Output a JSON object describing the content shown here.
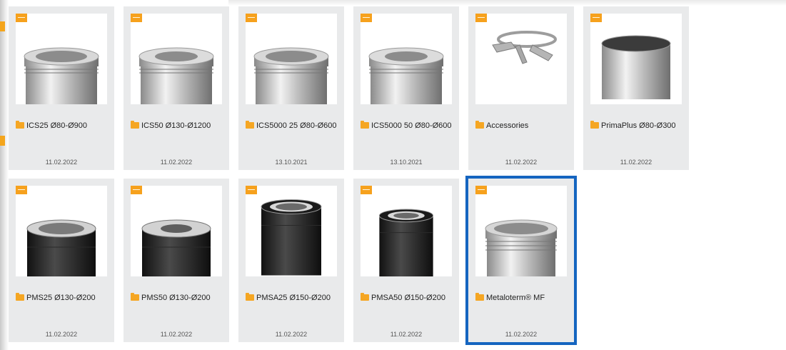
{
  "colors": {
    "tag": "#f6a11d",
    "folder": "#f5a623",
    "selection": "#1565c0",
    "card_bg": "#e9eaeb"
  },
  "folders": [
    {
      "name": "ICS25 Ø80-Ø900",
      "date": "11.02.2022",
      "icon": "folder-icon",
      "image": "steel-pipe"
    },
    {
      "name": "ICS50 Ø130-Ø1200",
      "date": "11.02.2022",
      "icon": "folder-icon",
      "image": "steel-pipe"
    },
    {
      "name": "ICS5000 25 Ø80-Ø600",
      "date": "13.10.2021",
      "icon": "folder-icon",
      "image": "steel-pipe"
    },
    {
      "name": "ICS5000 50 Ø80-Ø600",
      "date": "13.10.2021",
      "icon": "folder-icon",
      "image": "steel-pipe"
    },
    {
      "name": "Accessories",
      "date": "11.02.2022",
      "icon": "folder-icon",
      "image": "wall-bracket"
    },
    {
      "name": "PrimaPlus Ø80-Ø300",
      "date": "11.02.2022",
      "icon": "folder-icon",
      "image": "single-wall-pipe"
    },
    {
      "name": "PMS25 Ø130-Ø200",
      "date": "11.02.2022",
      "icon": "folder-icon",
      "image": "black-pipe"
    },
    {
      "name": "PMS50 Ø130-Ø200",
      "date": "11.02.2022",
      "icon": "folder-icon",
      "image": "black-pipe"
    },
    {
      "name": "PMSA25 Ø150-Ø200",
      "date": "11.02.2022",
      "icon": "folder-icon",
      "image": "black-coaxial-pipe"
    },
    {
      "name": "PMSA50 Ø150-Ø200",
      "date": "11.02.2022",
      "icon": "folder-icon",
      "image": "black-coaxial-pipe"
    },
    {
      "name": "Metaloterm® MF",
      "date": "11.02.2022",
      "icon": "folder-icon",
      "image": "steel-pipe",
      "selected": true
    }
  ]
}
